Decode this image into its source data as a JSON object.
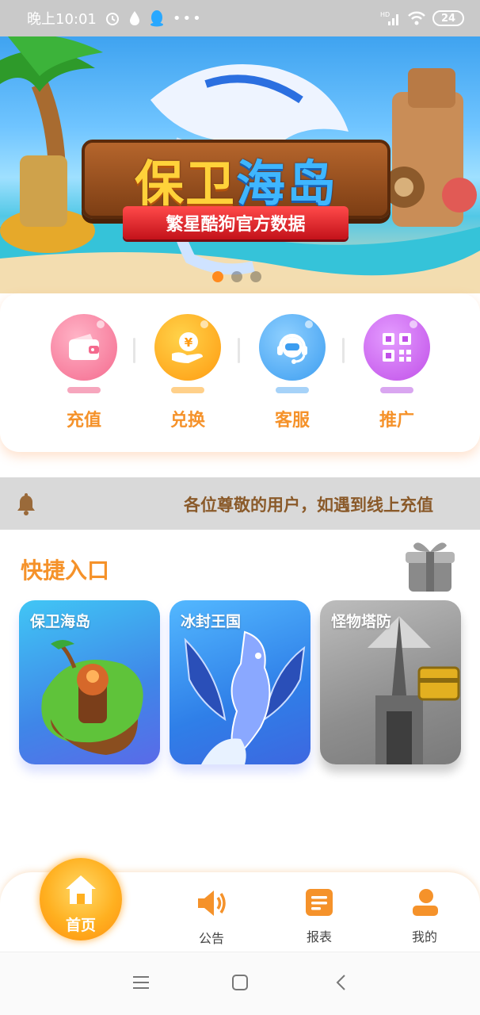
{
  "status_bar": {
    "time": "晚上10:01",
    "battery": "24",
    "network": "HD"
  },
  "banner": {
    "title_part1": "保卫",
    "title_part2": "海岛",
    "subtitle": "繁星酷狗官方数据",
    "dots": 3,
    "active_dot": 0
  },
  "actions": [
    {
      "label": "充值",
      "icon": "wallet-icon",
      "color": "#f46a8e"
    },
    {
      "label": "兑换",
      "icon": "yuan-hand-icon",
      "color": "#ffa31a"
    },
    {
      "label": "客服",
      "icon": "headset-icon",
      "color": "#3c9df0"
    },
    {
      "label": "推广",
      "icon": "qrcode-icon",
      "color": "#c04fe8"
    }
  ],
  "notice": {
    "text": "各位尊敬的用户，如遇到线上充值",
    "icon": "bell-icon"
  },
  "quick_entry": {
    "title": "快捷入口",
    "tiles": [
      {
        "name": "保卫海岛"
      },
      {
        "name": "冰封王国"
      },
      {
        "name": "怪物塔防"
      }
    ]
  },
  "bottom_nav": {
    "home": "首页",
    "items": [
      {
        "label": "公告",
        "icon": "speaker-icon"
      },
      {
        "label": "报表",
        "icon": "report-icon"
      },
      {
        "label": "我的",
        "icon": "user-icon"
      }
    ],
    "accent": "#f5922a"
  }
}
